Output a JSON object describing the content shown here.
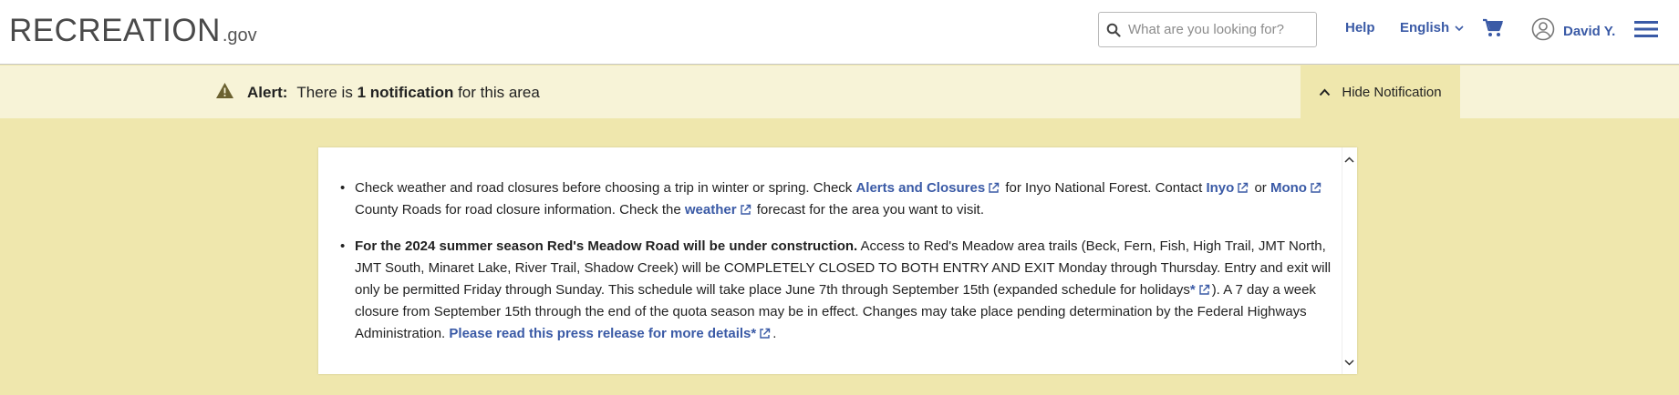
{
  "header": {
    "logo_main": "RECREATION",
    "logo_suffix": ".gov",
    "search_placeholder": "What are you looking for?",
    "help_label": "Help",
    "language_label": "English",
    "user_name": "David Y."
  },
  "alert": {
    "label": "Alert:",
    "text_prefix": "There is",
    "count_text": "1 notification",
    "text_suffix": "for this area",
    "hide_button": "Hide Notification"
  },
  "notifications": {
    "item1": {
      "t1": "Check weather and road closures before choosing a trip in winter or spring. Check",
      "link1": "Alerts and Closures",
      "t2": "for Inyo National Forest. Contact",
      "link2": "Inyo",
      "t3": "or",
      "link3": "Mono",
      "t4": "County Roads for road closure information. Check the",
      "link4": "weather",
      "t5": "forecast for the area you want to visit."
    },
    "item2": {
      "bold": "For the 2024 summer season Red's Meadow Road will be under construction.",
      "t1": "Access to Red's Meadow area trails (Beck, Fern, Fish, High Trail, JMT North, JMT South, Minaret Lake, River Trail, Shadow Creek) will be COMPLETELY CLOSED TO BOTH ENTRY AND EXIT Monday through Thursday. Entry and exit will only be permitted Friday through Sunday. This schedule will take place June 7th through September 15th (expanded schedule for holidays",
      "link1": "*",
      "t2": "). A 7 day a week closure from September 15th through the end of the quota season may be in effect. Changes may take place pending determination by the Federal Highways Administration.",
      "link2": "Please read this press release for more details*",
      "t3": "."
    }
  },
  "colors": {
    "link": "#3a5aa6",
    "alert_bg": "#f7f3d7",
    "page_bg": "#efe7ad",
    "alert_icon": "#6b6130"
  },
  "icons": [
    "search-icon",
    "chevron-down-icon",
    "cart-icon",
    "user-avatar-icon",
    "menu-icon",
    "warning-icon",
    "chevron-up-icon",
    "external-link-icon"
  ]
}
